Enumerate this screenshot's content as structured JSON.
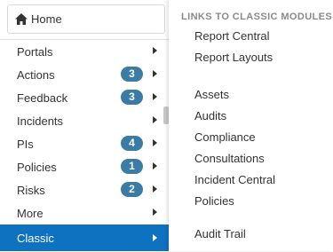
{
  "nav": {
    "home_label": "Home",
    "items": [
      {
        "label": "Portals",
        "badge": null
      },
      {
        "label": "Actions",
        "badge": "3"
      },
      {
        "label": "Feedback",
        "badge": "3"
      },
      {
        "label": "Incidents",
        "badge": null
      },
      {
        "label": "PIs",
        "badge": "4"
      },
      {
        "label": "Policies",
        "badge": "1"
      },
      {
        "label": "Risks",
        "badge": "2"
      },
      {
        "label": "More",
        "badge": null
      },
      {
        "label": "Classic",
        "badge": null,
        "active": true
      }
    ]
  },
  "submenu": {
    "header": "LINKS TO CLASSIC MODULES",
    "group1": [
      "Report Central",
      "Report Layouts"
    ],
    "group2": [
      "Assets",
      "Audits",
      "Compliance",
      "Consultations",
      "Incident Central",
      "Policies"
    ],
    "group3": [
      "Audit Trail"
    ]
  },
  "colors": {
    "active_bg": "#0f72c1",
    "badge_bg": "#3a7ca5",
    "header_text": "#8a8a8a"
  },
  "icons": {
    "home": "house-icon",
    "submenu_arrow": "chevron-right-icon"
  }
}
